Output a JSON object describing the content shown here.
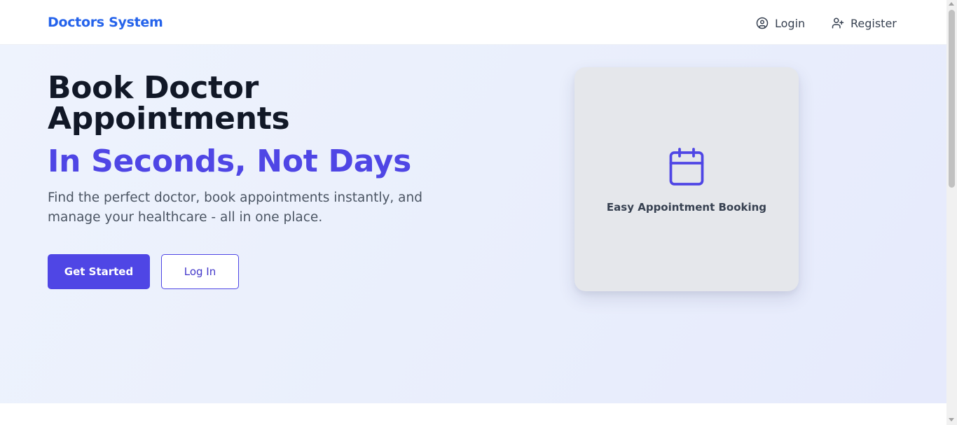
{
  "navbar": {
    "brand": "Doctors System",
    "login_label": "Login",
    "login_icon": "user-circle-icon",
    "register_label": "Register",
    "register_icon": "user-plus-icon"
  },
  "hero": {
    "headline": "Book Doctor Appointments",
    "headline_accent": "In Seconds, Not Days",
    "subtext": "Find the perfect doctor, book appointments instantly, and manage your healthcare - all in one place.",
    "primary_button": "Get Started",
    "secondary_button": "Log In"
  },
  "feature_card": {
    "icon": "calendar-icon",
    "label": "Easy Appointment Booking"
  },
  "colors": {
    "brand": "#2563eb",
    "accent": "#4f46e5",
    "heading": "#111827",
    "body_text": "#4b5563",
    "card_bg": "#e5e7eb"
  }
}
